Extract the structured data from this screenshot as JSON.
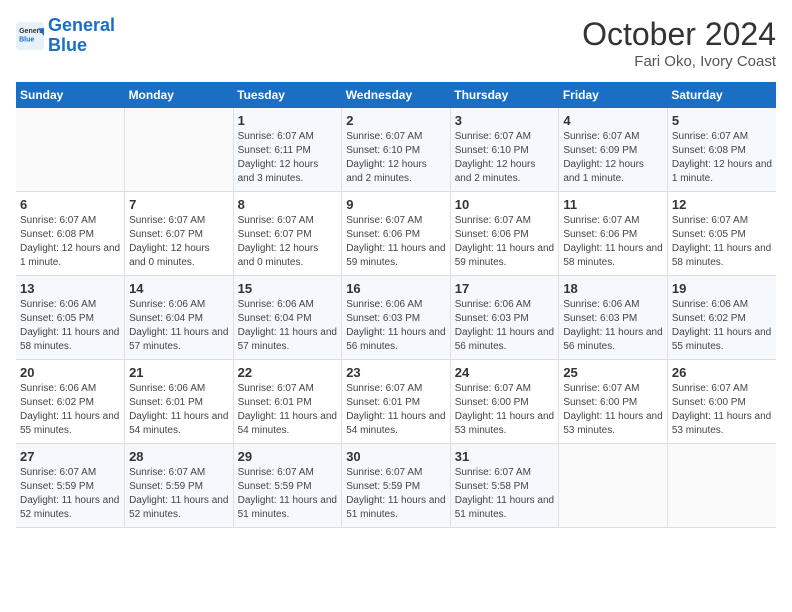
{
  "logo": {
    "line1": "General",
    "line2": "Blue"
  },
  "title": "October 2024",
  "subtitle": "Fari Oko, Ivory Coast",
  "days_header": [
    "Sunday",
    "Monday",
    "Tuesday",
    "Wednesday",
    "Thursday",
    "Friday",
    "Saturday"
  ],
  "weeks": [
    [
      {
        "day": "",
        "info": ""
      },
      {
        "day": "",
        "info": ""
      },
      {
        "day": "1",
        "info": "Sunrise: 6:07 AM\nSunset: 6:11 PM\nDaylight: 12 hours and 3 minutes."
      },
      {
        "day": "2",
        "info": "Sunrise: 6:07 AM\nSunset: 6:10 PM\nDaylight: 12 hours and 2 minutes."
      },
      {
        "day": "3",
        "info": "Sunrise: 6:07 AM\nSunset: 6:10 PM\nDaylight: 12 hours and 2 minutes."
      },
      {
        "day": "4",
        "info": "Sunrise: 6:07 AM\nSunset: 6:09 PM\nDaylight: 12 hours and 1 minute."
      },
      {
        "day": "5",
        "info": "Sunrise: 6:07 AM\nSunset: 6:08 PM\nDaylight: 12 hours and 1 minute."
      }
    ],
    [
      {
        "day": "6",
        "info": "Sunrise: 6:07 AM\nSunset: 6:08 PM\nDaylight: 12 hours and 1 minute."
      },
      {
        "day": "7",
        "info": "Sunrise: 6:07 AM\nSunset: 6:07 PM\nDaylight: 12 hours and 0 minutes."
      },
      {
        "day": "8",
        "info": "Sunrise: 6:07 AM\nSunset: 6:07 PM\nDaylight: 12 hours and 0 minutes."
      },
      {
        "day": "9",
        "info": "Sunrise: 6:07 AM\nSunset: 6:06 PM\nDaylight: 11 hours and 59 minutes."
      },
      {
        "day": "10",
        "info": "Sunrise: 6:07 AM\nSunset: 6:06 PM\nDaylight: 11 hours and 59 minutes."
      },
      {
        "day": "11",
        "info": "Sunrise: 6:07 AM\nSunset: 6:06 PM\nDaylight: 11 hours and 58 minutes."
      },
      {
        "day": "12",
        "info": "Sunrise: 6:07 AM\nSunset: 6:05 PM\nDaylight: 11 hours and 58 minutes."
      }
    ],
    [
      {
        "day": "13",
        "info": "Sunrise: 6:06 AM\nSunset: 6:05 PM\nDaylight: 11 hours and 58 minutes."
      },
      {
        "day": "14",
        "info": "Sunrise: 6:06 AM\nSunset: 6:04 PM\nDaylight: 11 hours and 57 minutes."
      },
      {
        "day": "15",
        "info": "Sunrise: 6:06 AM\nSunset: 6:04 PM\nDaylight: 11 hours and 57 minutes."
      },
      {
        "day": "16",
        "info": "Sunrise: 6:06 AM\nSunset: 6:03 PM\nDaylight: 11 hours and 56 minutes."
      },
      {
        "day": "17",
        "info": "Sunrise: 6:06 AM\nSunset: 6:03 PM\nDaylight: 11 hours and 56 minutes."
      },
      {
        "day": "18",
        "info": "Sunrise: 6:06 AM\nSunset: 6:03 PM\nDaylight: 11 hours and 56 minutes."
      },
      {
        "day": "19",
        "info": "Sunrise: 6:06 AM\nSunset: 6:02 PM\nDaylight: 11 hours and 55 minutes."
      }
    ],
    [
      {
        "day": "20",
        "info": "Sunrise: 6:06 AM\nSunset: 6:02 PM\nDaylight: 11 hours and 55 minutes."
      },
      {
        "day": "21",
        "info": "Sunrise: 6:06 AM\nSunset: 6:01 PM\nDaylight: 11 hours and 54 minutes."
      },
      {
        "day": "22",
        "info": "Sunrise: 6:07 AM\nSunset: 6:01 PM\nDaylight: 11 hours and 54 minutes."
      },
      {
        "day": "23",
        "info": "Sunrise: 6:07 AM\nSunset: 6:01 PM\nDaylight: 11 hours and 54 minutes."
      },
      {
        "day": "24",
        "info": "Sunrise: 6:07 AM\nSunset: 6:00 PM\nDaylight: 11 hours and 53 minutes."
      },
      {
        "day": "25",
        "info": "Sunrise: 6:07 AM\nSunset: 6:00 PM\nDaylight: 11 hours and 53 minutes."
      },
      {
        "day": "26",
        "info": "Sunrise: 6:07 AM\nSunset: 6:00 PM\nDaylight: 11 hours and 53 minutes."
      }
    ],
    [
      {
        "day": "27",
        "info": "Sunrise: 6:07 AM\nSunset: 5:59 PM\nDaylight: 11 hours and 52 minutes."
      },
      {
        "day": "28",
        "info": "Sunrise: 6:07 AM\nSunset: 5:59 PM\nDaylight: 11 hours and 52 minutes."
      },
      {
        "day": "29",
        "info": "Sunrise: 6:07 AM\nSunset: 5:59 PM\nDaylight: 11 hours and 51 minutes."
      },
      {
        "day": "30",
        "info": "Sunrise: 6:07 AM\nSunset: 5:59 PM\nDaylight: 11 hours and 51 minutes."
      },
      {
        "day": "31",
        "info": "Sunrise: 6:07 AM\nSunset: 5:58 PM\nDaylight: 11 hours and 51 minutes."
      },
      {
        "day": "",
        "info": ""
      },
      {
        "day": "",
        "info": ""
      }
    ]
  ]
}
